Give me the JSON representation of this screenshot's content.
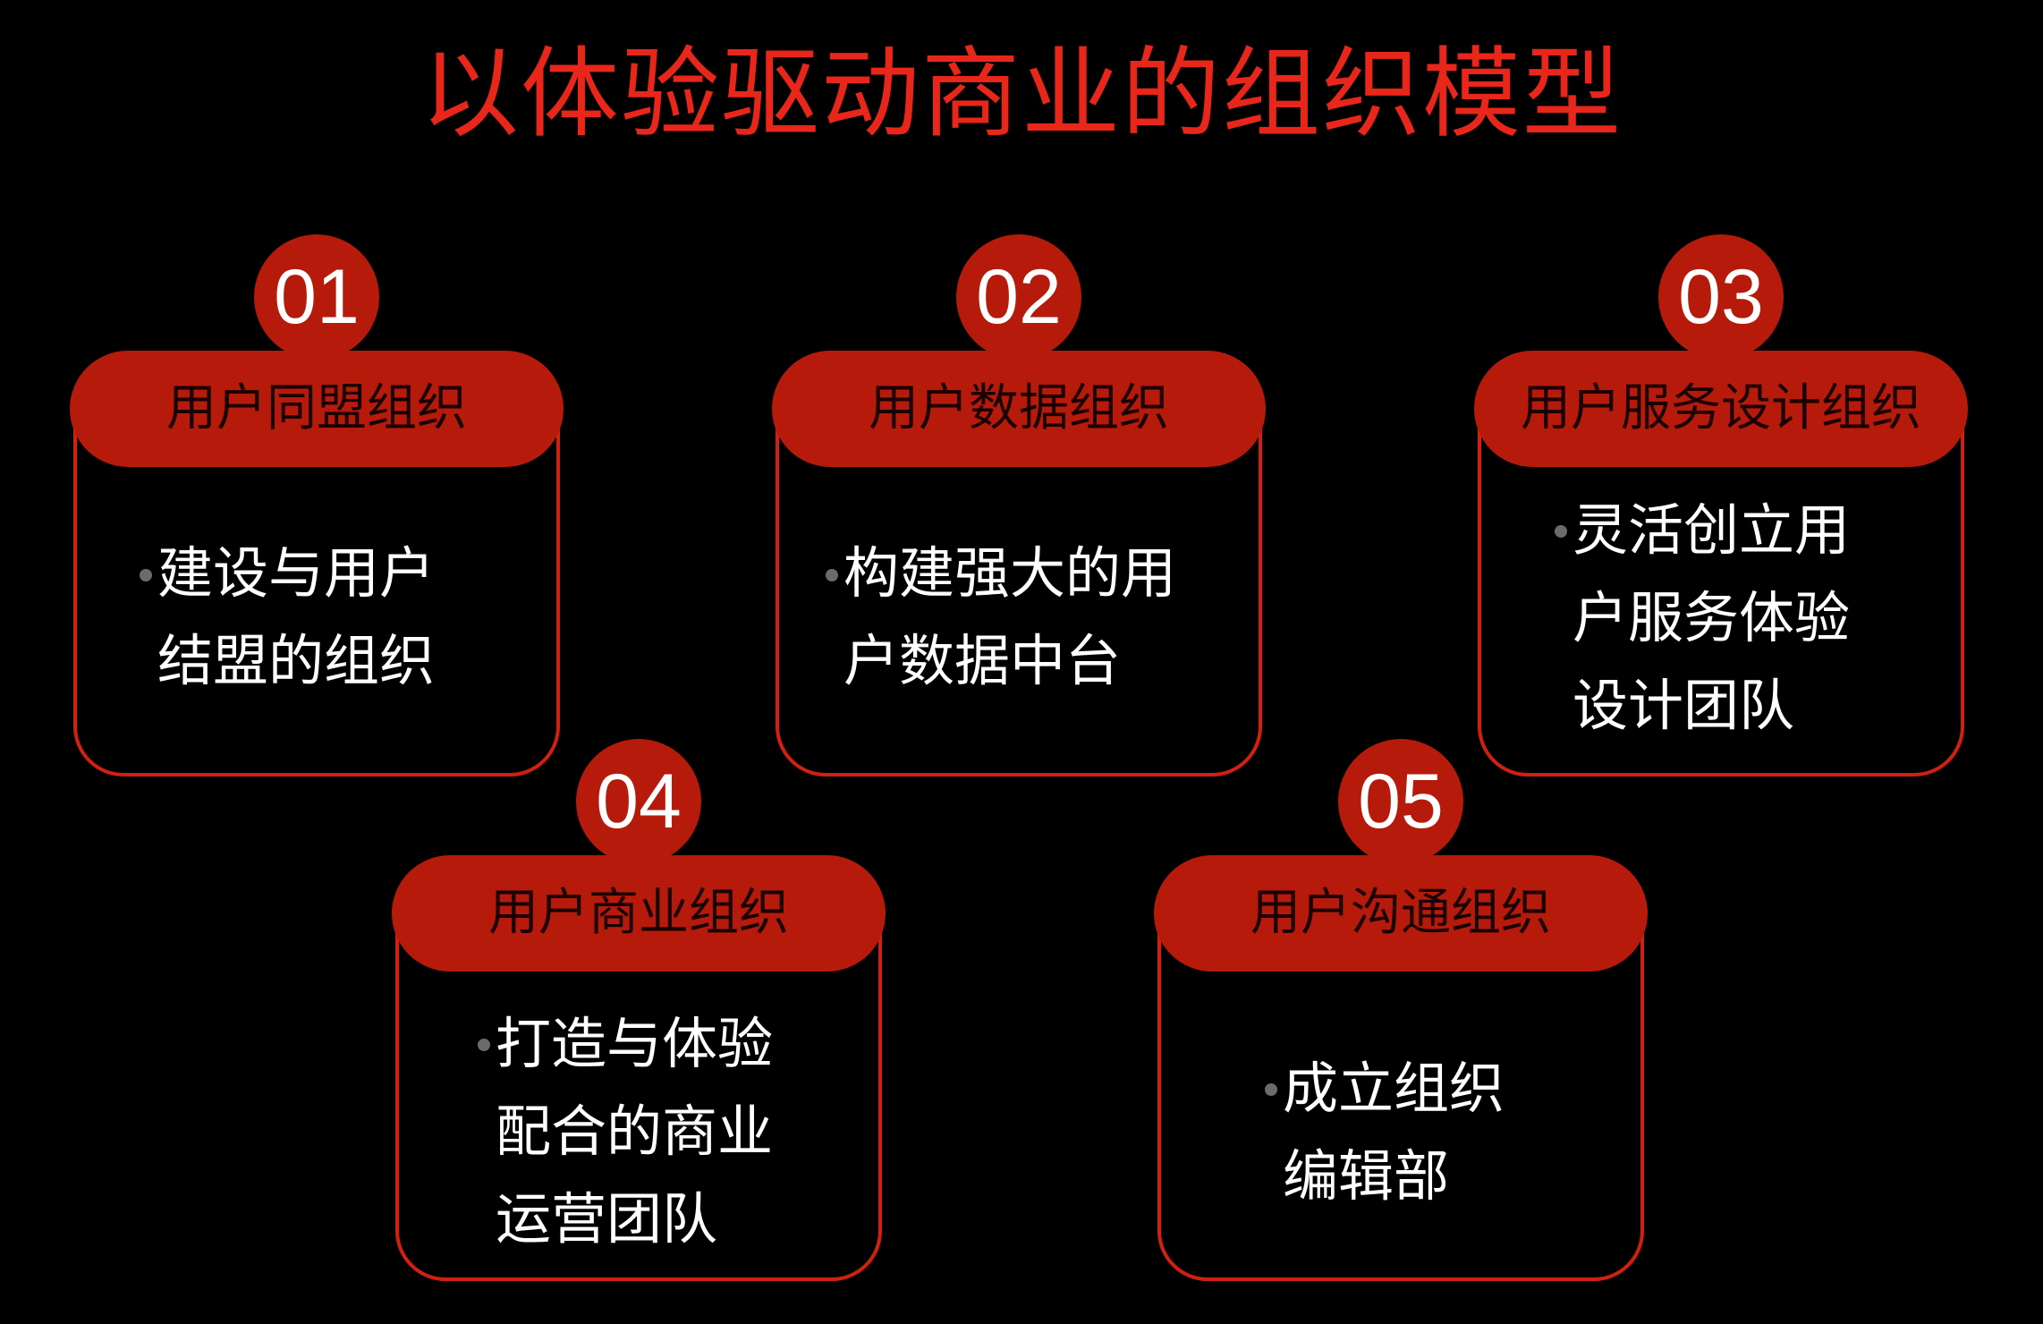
{
  "title": "以体验驱动商业的组织模型",
  "colors": {
    "background": "#000000",
    "accent": "#b51a0a",
    "title": "#e8261a",
    "border": "#d11f10",
    "text": "#ffffff"
  },
  "cards": [
    {
      "number": "01",
      "heading": "用户同盟组织",
      "lines": [
        "建设与用户",
        "结盟的组织"
      ]
    },
    {
      "number": "02",
      "heading": "用户数据组织",
      "lines": [
        "构建强大的用",
        "户数据中台"
      ]
    },
    {
      "number": "03",
      "heading": "用户服务设计组织",
      "lines": [
        "灵活创立用",
        "户服务体验",
        "设计团队"
      ]
    },
    {
      "number": "04",
      "heading": "用户商业组织",
      "lines": [
        "打造与体验",
        "配合的商业",
        "运营团队"
      ]
    },
    {
      "number": "05",
      "heading": "用户沟通组织",
      "lines": [
        "成立组织",
        "编辑部"
      ]
    }
  ]
}
